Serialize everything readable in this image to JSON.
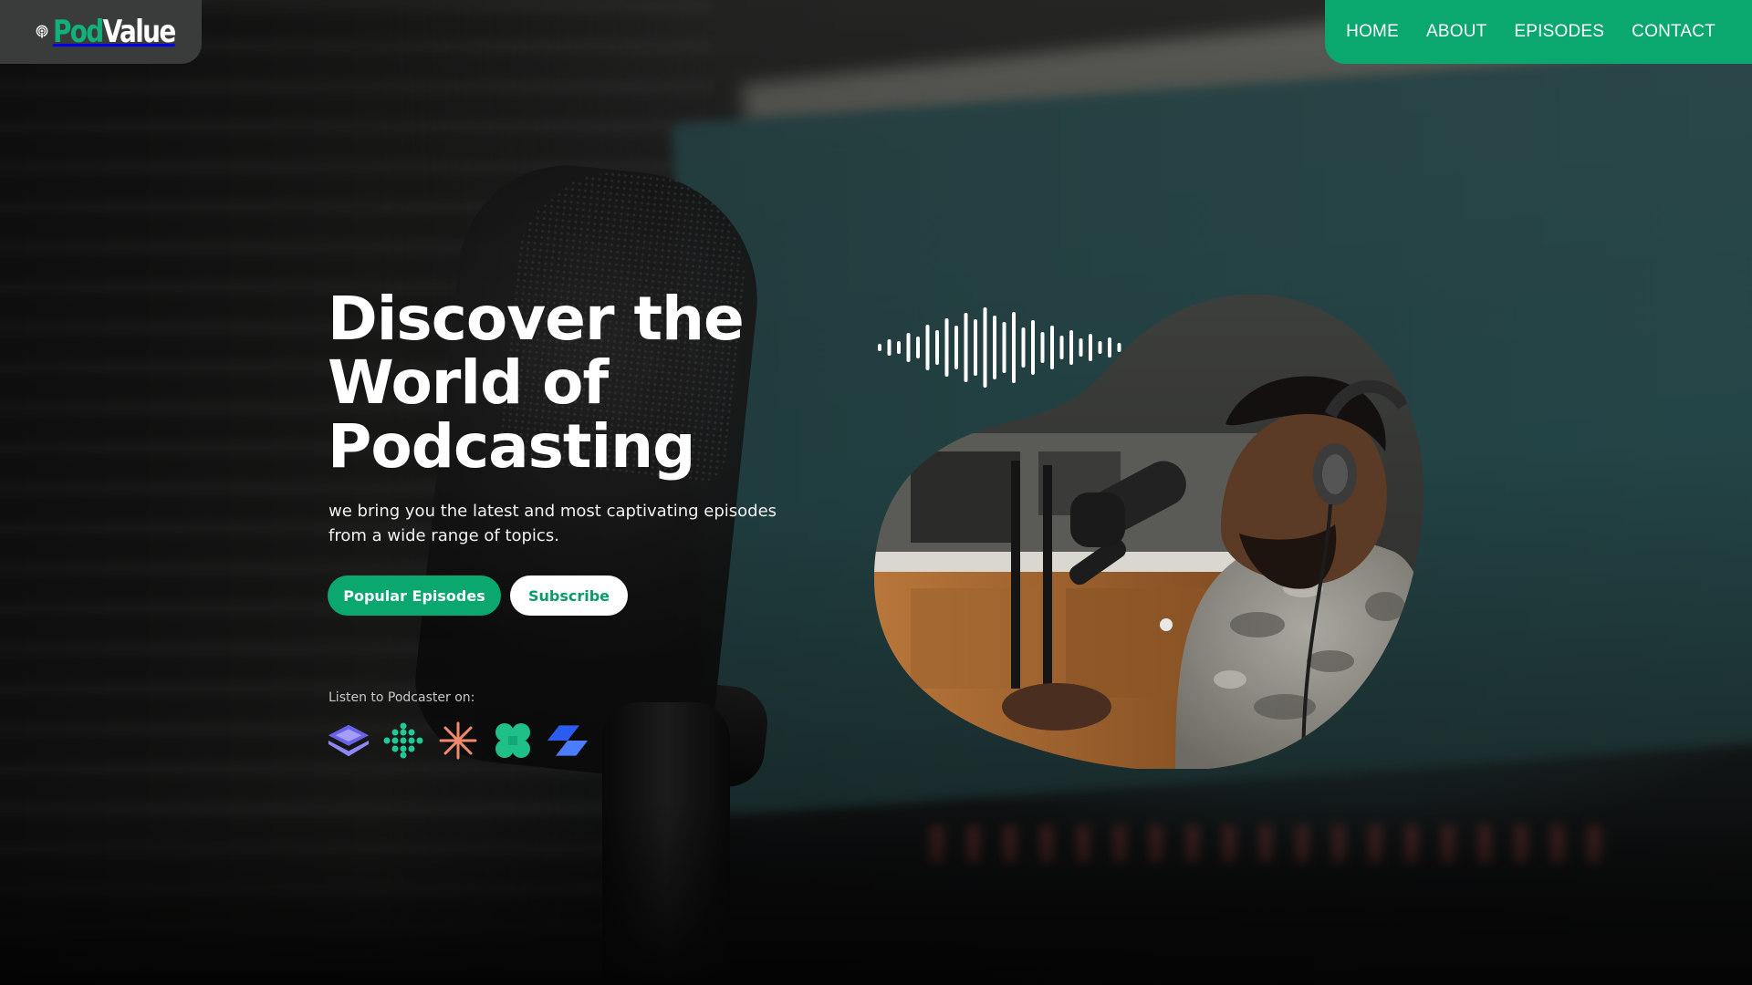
{
  "brand": {
    "logo_pod": "Pod",
    "logo_value": "Value",
    "accent": "#0aa86e"
  },
  "nav": {
    "items": [
      {
        "label": "HOME"
      },
      {
        "label": "ABOUT"
      },
      {
        "label": "EPISODES"
      },
      {
        "label": "CONTACT"
      }
    ]
  },
  "hero": {
    "title_lines": [
      "Discover the",
      "World of",
      "Podcasting"
    ],
    "subtitle_line1": "we bring you the latest and most captivating episodes",
    "subtitle_line2": "from a wide range of topics.",
    "primary_button": "Popular Episodes",
    "secondary_button": "Subscribe",
    "listen_label": "Listen to Podcaster on:",
    "platform_icons": [
      "layers-icon",
      "dots-cluster-icon",
      "asterisk-icon",
      "clover-icon",
      "stripes-icon"
    ]
  },
  "media": {
    "waveform_icon": "audio-waveform-icon",
    "photo_subject": "podcaster-photo"
  }
}
